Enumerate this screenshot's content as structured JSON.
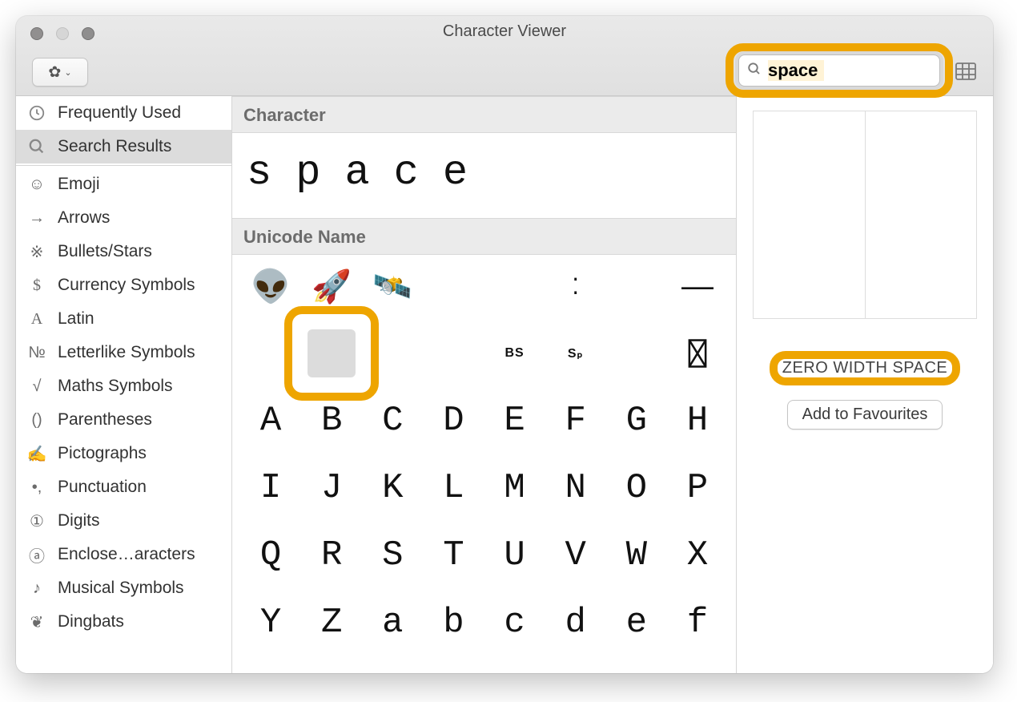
{
  "window": {
    "title": "Character Viewer"
  },
  "search": {
    "value": "space"
  },
  "sidebar": {
    "top": [
      {
        "icon": "🕘",
        "label": "Frequently Used"
      },
      {
        "icon": "🔍",
        "label": "Search Results"
      }
    ],
    "items": [
      {
        "icon": "☺",
        "label": "Emoji"
      },
      {
        "icon": "→",
        "label": "Arrows"
      },
      {
        "icon": "✳",
        "label": "Bullets/Stars"
      },
      {
        "icon": "$",
        "label": "Currency Symbols"
      },
      {
        "icon": "A",
        "label": "Latin"
      },
      {
        "icon": "№",
        "label": "Letterlike Symbols"
      },
      {
        "icon": "√",
        "label": "Maths Symbols"
      },
      {
        "icon": "()",
        "label": "Parentheses"
      },
      {
        "icon": "✍",
        "label": "Pictographs"
      },
      {
        "icon": "•,",
        "label": "Punctuation"
      },
      {
        "icon": "①",
        "label": "Digits"
      },
      {
        "icon": "ⓐ",
        "label": "Enclose…aracters"
      },
      {
        "icon": "♪",
        "label": "Musical Symbols"
      },
      {
        "icon": "❦",
        "label": "Dingbats"
      }
    ]
  },
  "main": {
    "heading1": "Character",
    "heading2": "Unicode Name",
    "charRow": [
      "s",
      "p",
      "a",
      "c",
      "e"
    ],
    "row1": [
      "👽",
      "🚀",
      "🛰️",
      "",
      "",
      "⁚",
      "",
      "—"
    ],
    "row2": [
      "",
      "SEL",
      "",
      "",
      "BS",
      "Sₚ",
      "",
      "BOX"
    ],
    "row3": [
      "A",
      "B",
      "C",
      "D",
      "E",
      "F",
      "G",
      "H"
    ],
    "row4": [
      "I",
      "J",
      "K",
      "L",
      "M",
      "N",
      "O",
      "P"
    ],
    "row5": [
      "Q",
      "R",
      "S",
      "T",
      "U",
      "V",
      "W",
      "X"
    ],
    "row6": [
      "Y",
      "Z",
      "a",
      "b",
      "c",
      "d",
      "e",
      "f"
    ]
  },
  "detail": {
    "name": "ZERO WIDTH SPACE",
    "favBtn": "Add to Favourites"
  }
}
